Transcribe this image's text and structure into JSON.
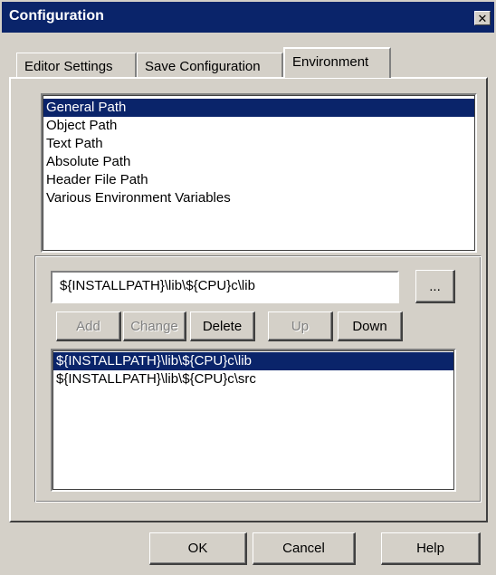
{
  "window": {
    "title": "Configuration",
    "close_glyph": "✕"
  },
  "tabs": [
    {
      "label": "Editor Settings",
      "active": false
    },
    {
      "label": "Save Configuration",
      "active": false
    },
    {
      "label": "Environment",
      "active": true
    }
  ],
  "path_categories": {
    "items": [
      "General Path",
      "Object Path",
      "Text Path",
      "Absolute Path",
      "Header File Path",
      "Various Environment Variables"
    ],
    "selected": "General Path"
  },
  "path_editor": {
    "value": "${INSTALLPATH}\\lib\\${CPU}c\\lib",
    "browse_label": "...",
    "buttons": {
      "add": "Add",
      "change": "Change",
      "delete": "Delete",
      "up": "Up",
      "down": "Down"
    },
    "paths": [
      "${INSTALLPATH}\\lib\\${CPU}c\\lib",
      "${INSTALLPATH}\\lib\\${CPU}c\\src"
    ],
    "selected": "${INSTALLPATH}\\lib\\${CPU}c\\lib"
  },
  "footer": {
    "ok": "OK",
    "cancel": "Cancel",
    "help": "Help"
  }
}
